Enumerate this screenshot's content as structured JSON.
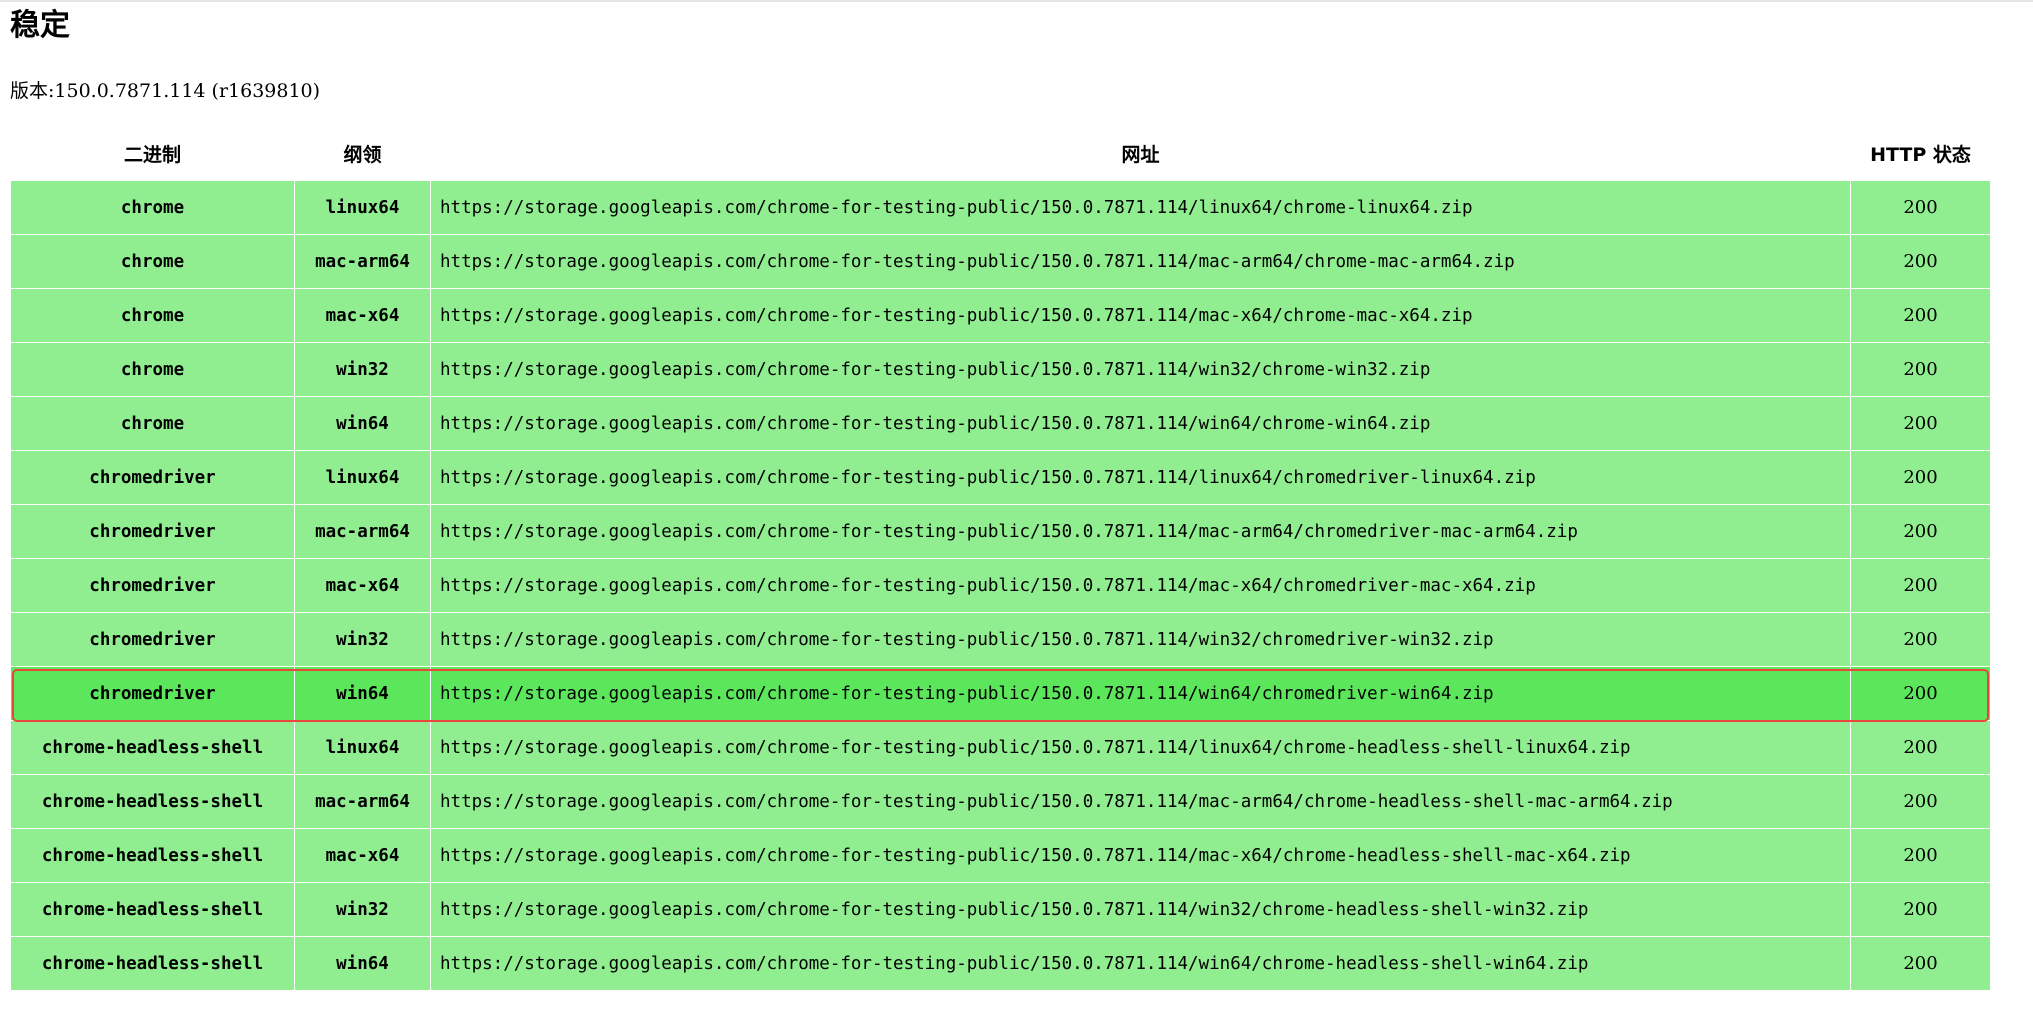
{
  "page": {
    "title": "稳定",
    "version_label": "版本:",
    "version_value": "150.0.7871.114 (r1639810)"
  },
  "table": {
    "headers": [
      "二进制",
      "纲领",
      "网址",
      "HTTP 状态"
    ],
    "rows": [
      {
        "binary": "chrome",
        "platform": "linux64",
        "url": "https://storage.googleapis.com/chrome-for-testing-public/150.0.7871.114/linux64/chrome-linux64.zip",
        "status": "200"
      },
      {
        "binary": "chrome",
        "platform": "mac-arm64",
        "url": "https://storage.googleapis.com/chrome-for-testing-public/150.0.7871.114/mac-arm64/chrome-mac-arm64.zip",
        "status": "200"
      },
      {
        "binary": "chrome",
        "platform": "mac-x64",
        "url": "https://storage.googleapis.com/chrome-for-testing-public/150.0.7871.114/mac-x64/chrome-mac-x64.zip",
        "status": "200"
      },
      {
        "binary": "chrome",
        "platform": "win32",
        "url": "https://storage.googleapis.com/chrome-for-testing-public/150.0.7871.114/win32/chrome-win32.zip",
        "status": "200"
      },
      {
        "binary": "chrome",
        "platform": "win64",
        "url": "https://storage.googleapis.com/chrome-for-testing-public/150.0.7871.114/win64/chrome-win64.zip",
        "status": "200"
      },
      {
        "binary": "chromedriver",
        "platform": "linux64",
        "url": "https://storage.googleapis.com/chrome-for-testing-public/150.0.7871.114/linux64/chromedriver-linux64.zip",
        "status": "200"
      },
      {
        "binary": "chromedriver",
        "platform": "mac-arm64",
        "url": "https://storage.googleapis.com/chrome-for-testing-public/150.0.7871.114/mac-arm64/chromedriver-mac-arm64.zip",
        "status": "200"
      },
      {
        "binary": "chromedriver",
        "platform": "mac-x64",
        "url": "https://storage.googleapis.com/chrome-for-testing-public/150.0.7871.114/mac-x64/chromedriver-mac-x64.zip",
        "status": "200"
      },
      {
        "binary": "chromedriver",
        "platform": "win32",
        "url": "https://storage.googleapis.com/chrome-for-testing-public/150.0.7871.114/win32/chromedriver-win32.zip",
        "status": "200"
      },
      {
        "binary": "chromedriver",
        "platform": "win64",
        "url": "https://storage.googleapis.com/chrome-for-testing-public/150.0.7871.114/win64/chromedriver-win64.zip",
        "status": "200",
        "highlighted": true
      },
      {
        "binary": "chrome-headless-shell",
        "platform": "linux64",
        "url": "https://storage.googleapis.com/chrome-for-testing-public/150.0.7871.114/linux64/chrome-headless-shell-linux64.zip",
        "status": "200"
      },
      {
        "binary": "chrome-headless-shell",
        "platform": "mac-arm64",
        "url": "https://storage.googleapis.com/chrome-for-testing-public/150.0.7871.114/mac-arm64/chrome-headless-shell-mac-arm64.zip",
        "status": "200"
      },
      {
        "binary": "chrome-headless-shell",
        "platform": "mac-x64",
        "url": "https://storage.googleapis.com/chrome-for-testing-public/150.0.7871.114/mac-x64/chrome-headless-shell-mac-x64.zip",
        "status": "200"
      },
      {
        "binary": "chrome-headless-shell",
        "platform": "win32",
        "url": "https://storage.googleapis.com/chrome-for-testing-public/150.0.7871.114/win32/chrome-headless-shell-win32.zip",
        "status": "200"
      },
      {
        "binary": "chrome-headless-shell",
        "platform": "win64",
        "url": "https://storage.googleapis.com/chrome-for-testing-public/150.0.7871.114/win64/chrome-headless-shell-win64.zip",
        "status": "200"
      }
    ]
  },
  "colors": {
    "row_background": "#90ee90",
    "highlighted_row_background": "#5ce65c",
    "selection_outline": "#e8453c"
  }
}
